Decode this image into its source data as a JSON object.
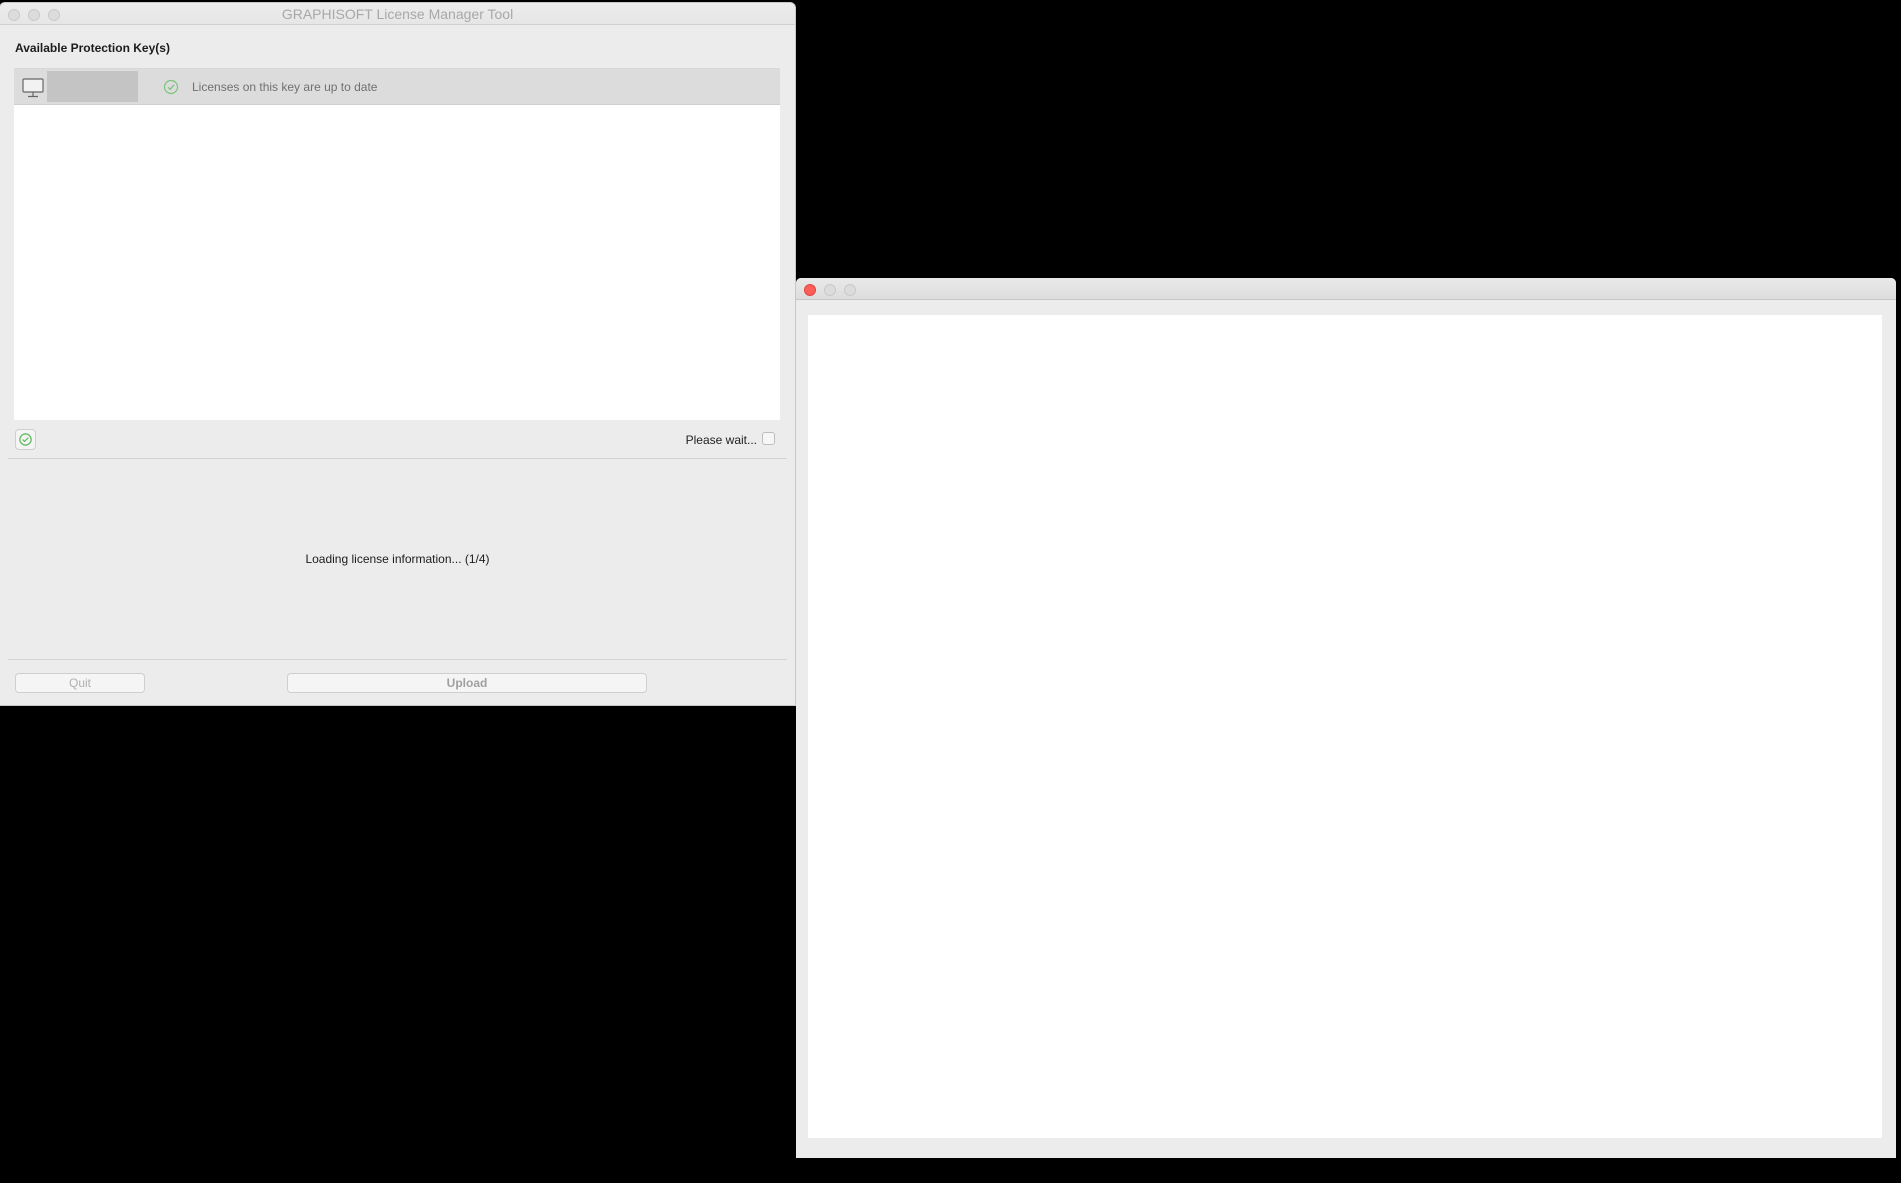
{
  "main_window": {
    "title": "GRAPHISOFT License Manager Tool",
    "section_label": "Available Protection Key(s)",
    "keys": [
      {
        "icon": "monitor-icon",
        "status_icon": "check-circle-icon",
        "status_text": "Licenses on this key are up to date"
      }
    ],
    "refresh_icon": "refresh-icon",
    "status_text": "Please wait...",
    "loading_text": "Loading license information... (1/4)",
    "buttons": {
      "quit_label": "Quit",
      "upload_label": "Upload"
    }
  },
  "secondary_window": {
    "title": ""
  },
  "colors": {
    "close_button": "#fc5f57",
    "status_green": "#5cb85c",
    "window_bg": "#ececec"
  }
}
